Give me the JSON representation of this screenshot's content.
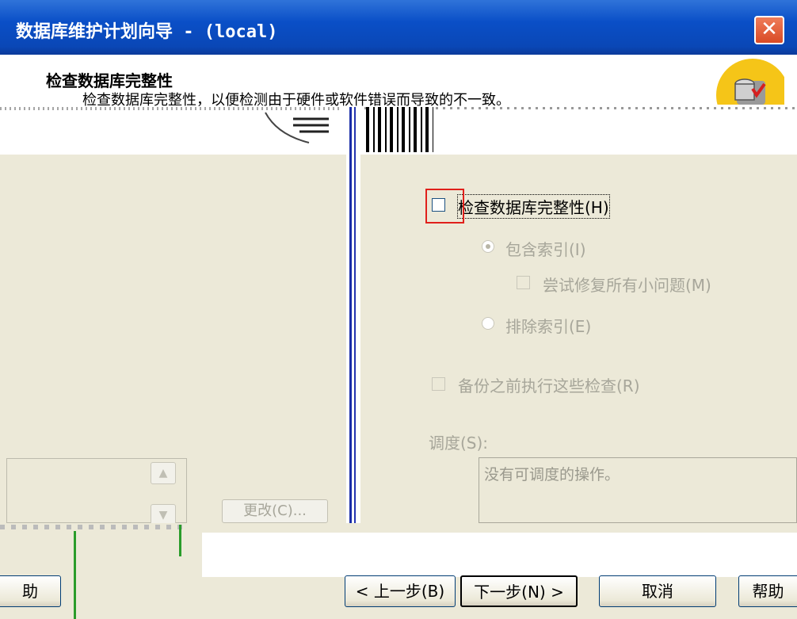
{
  "window": {
    "title": "数据库维护计划向导 - (local)",
    "close_glyph": "✕"
  },
  "header": {
    "heading": "检查数据库完整性",
    "subheading": "检查数据库完整性，以便检测由于硬件或软件错误而导致的不一致。"
  },
  "options": {
    "check_integrity": {
      "label": "检查数据库完整性(H)",
      "checked": false
    },
    "include_indexes": {
      "label": "包含索引(I)",
      "selected": true,
      "enabled": false
    },
    "attempt_repair": {
      "label": "尝试修复所有小问题(M)",
      "checked": false,
      "enabled": false
    },
    "exclude_indexes": {
      "label": "排除索引(E)",
      "selected": false,
      "enabled": false
    },
    "run_before_backup": {
      "label": "备份之前执行这些检查(R)",
      "checked": false,
      "enabled": false
    }
  },
  "schedule": {
    "label": "调度(S):",
    "text": "没有可调度的操作。"
  },
  "left_panel": {
    "change_button": "更改(C)...",
    "scroll_up_glyph": "▲",
    "scroll_down_glyph": "▼"
  },
  "footer": {
    "partial_left_button": "助",
    "back_button": "< 上一步(B)",
    "next_button": "下一步(N) >",
    "cancel_button": "取消",
    "help_button": "帮助"
  },
  "colors": {
    "title_bar": "#0a4fc7",
    "dialog_face": "#ECE9D8",
    "highlight_box": "#e0201b",
    "close_button": "#d94a25"
  },
  "icons": {
    "wizard_icon": "database-check-icon"
  }
}
